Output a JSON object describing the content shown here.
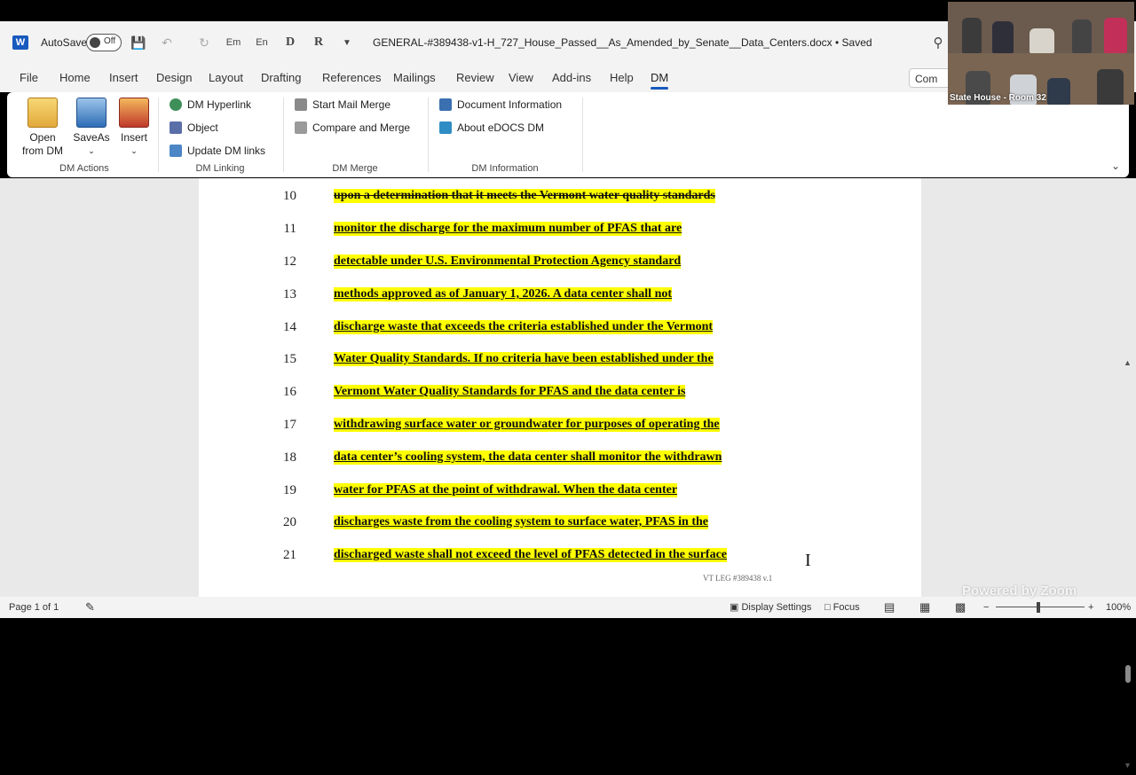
{
  "titlebar": {
    "autosave_label": "AutoSave",
    "autosave_state": "Off",
    "document_title": "GENERAL-#389438-v1-H_727_House_Passed__As_Amended_by_Senate__Data_Centers.docx • Saved",
    "quick_icons": {
      "em": "Em",
      "en": "En",
      "d": "D",
      "r": "R"
    }
  },
  "menu": {
    "items": [
      "File",
      "Home",
      "Insert",
      "Design",
      "Layout",
      "Drafting",
      "References",
      "Mailings",
      "Review",
      "View",
      "Add-ins",
      "Help",
      "DM"
    ],
    "active": "DM",
    "comments_label": "Com"
  },
  "ribbon": {
    "dm_actions": {
      "label": "DM Actions",
      "open_label": "Open\nfrom DM",
      "saveas_label": "SaveAs",
      "insert_label": "Insert"
    },
    "dm_linking": {
      "label": "DM Linking",
      "items": [
        "DM Hyperlink",
        "Object",
        "Update DM links"
      ]
    },
    "dm_merge": {
      "label": "DM Merge",
      "items": [
        "Start Mail Merge",
        "Compare and Merge"
      ]
    },
    "dm_information": {
      "label": "DM Information",
      "items": [
        "Document Information",
        "About eDOCS DM"
      ]
    }
  },
  "document": {
    "lines": [
      {
        "num": "10",
        "text": "upon a determination that it meets the Vermont water quality standards",
        "strike": true
      },
      {
        "num": "11",
        "text": "monitor the discharge for the maximum number of PFAS that are",
        "strike": false
      },
      {
        "num": "12",
        "text": "detectable under U.S. Environmental Protection Agency standard",
        "strike": false
      },
      {
        "num": "13",
        "text": "methods approved as of January 1, 2026.  A data center shall not",
        "strike": false
      },
      {
        "num": "14",
        "text": "discharge waste that exceeds the criteria established under the Vermont",
        "strike": false
      },
      {
        "num": "15",
        "text": "Water Quality Standards.  If no criteria have been established under the",
        "strike": false
      },
      {
        "num": "16",
        "text": "Vermont Water Quality Standards for PFAS and the data center is",
        "strike": false
      },
      {
        "num": "17",
        "text": "withdrawing surface water or groundwater for purposes of operating the",
        "strike": false
      },
      {
        "num": "18",
        "text": "data center’s cooling system, the data center shall monitor the withdrawn",
        "strike": false
      },
      {
        "num": "19",
        "text": "water for PFAS at the point of withdrawal.  When the data center",
        "strike": false
      },
      {
        "num": "20",
        "text": "discharges waste from the cooling system to surface water, PFAS in the",
        "strike": false
      },
      {
        "num": "21",
        "text": "discharged waste shall not exceed the level of PFAS detected in the surface",
        "strike": false
      }
    ],
    "footer_text": "VT LEG #389438 v.1"
  },
  "status": {
    "page": "Page 1 of 1",
    "display_settings": "Display Settings",
    "focus": "Focus",
    "zoom": "100%"
  },
  "overlay": {
    "video_label": "State House - Room 32",
    "watermark": "Powered by Zoom"
  },
  "colors": {
    "highlight": "#ffff00",
    "word_blue": "#185abd",
    "chrome": "#f3f3f3",
    "doc_background": "#e9e9e9"
  }
}
